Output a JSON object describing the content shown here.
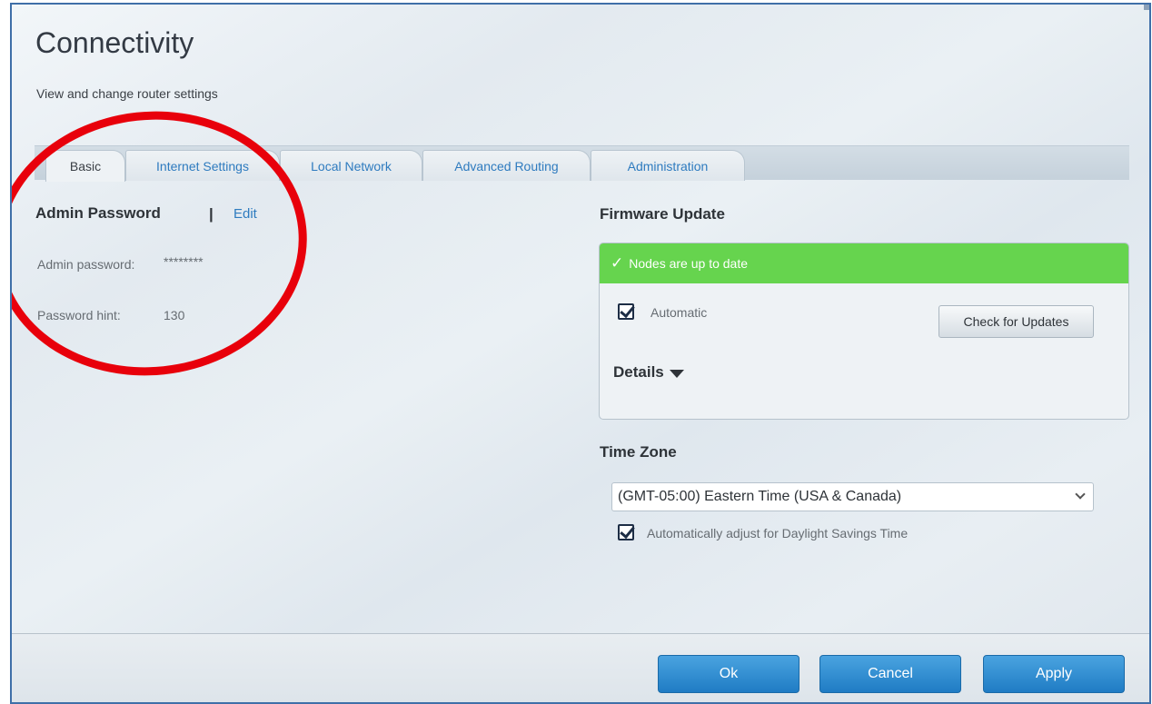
{
  "page": {
    "title": "Connectivity",
    "subtitle": "View and change router settings"
  },
  "tabs": [
    {
      "label": "Basic",
      "active": true
    },
    {
      "label": "Internet Settings",
      "active": false
    },
    {
      "label": "Local Network",
      "active": false
    },
    {
      "label": "Advanced Routing",
      "active": false
    },
    {
      "label": "Administration",
      "active": false
    }
  ],
  "admin": {
    "heading": "Admin Password",
    "separator": "|",
    "edit_label": "Edit",
    "password_label": "Admin password:",
    "password_value": "********",
    "hint_label": "Password hint:",
    "hint_value": "130"
  },
  "firmware": {
    "heading": "Firmware Update",
    "status": "Nodes are up to date",
    "status_color": "#66d44e",
    "automatic_label": "Automatic",
    "automatic_checked": true,
    "check_button": "Check for Updates",
    "details_label": "Details"
  },
  "timezone": {
    "heading": "Time Zone",
    "selected": "(GMT-05:00) Eastern Time (USA & Canada)",
    "dst_label": "Automatically adjust for Daylight Savings Time",
    "dst_checked": true
  },
  "footer": {
    "ok_label": "Ok",
    "cancel_label": "Cancel",
    "apply_label": "Apply",
    "button_color": "#2a8ad2"
  },
  "annotation": {
    "shape": "circle",
    "color": "#e8000b"
  },
  "icons": {
    "status": "checkmark-icon",
    "details": "caret-down-icon",
    "select": "chevron-down-icon"
  }
}
